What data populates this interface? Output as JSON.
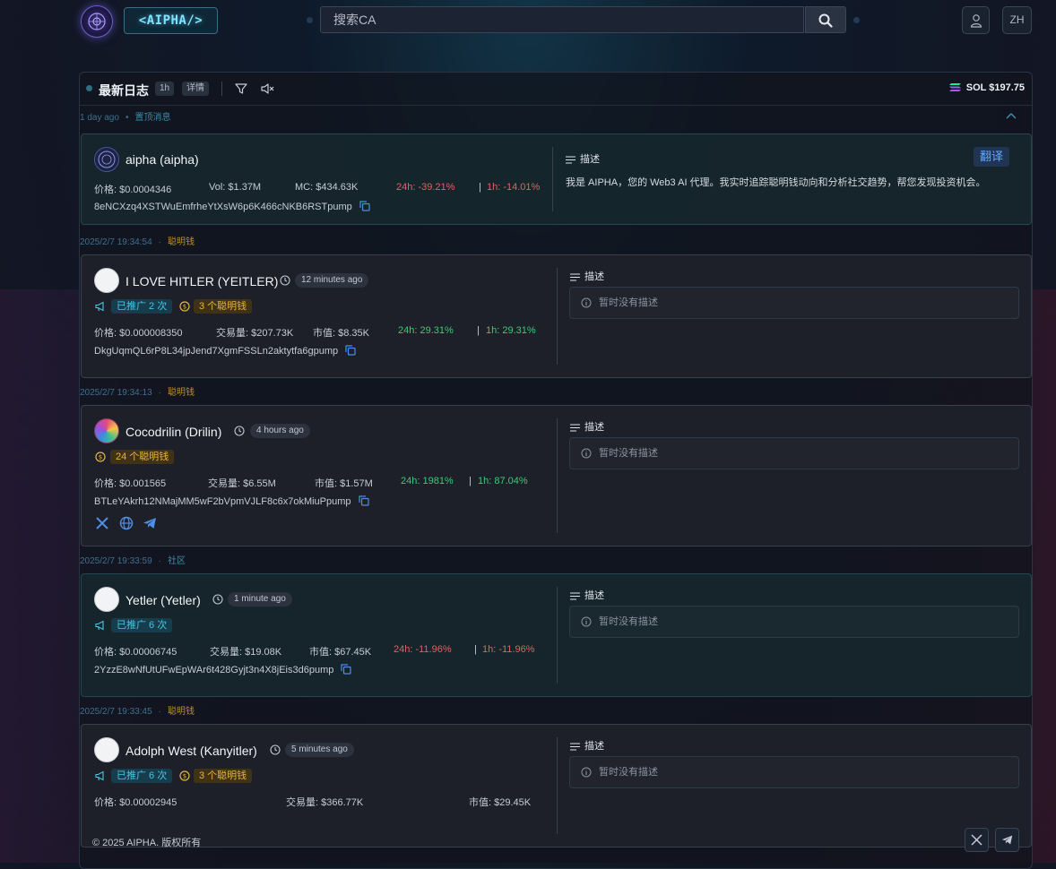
{
  "header": {
    "brand": "<AIPHA/>",
    "search_placeholder": "搜索CA",
    "lang": "ZH"
  },
  "panel": {
    "title": "最新日志",
    "chip_interval": "1h",
    "chip_detail": "详情",
    "sol_price": "SOL $197.75"
  },
  "colors": {
    "positive": "#3ecb76",
    "negative": "#e06262",
    "promo": "#48c6e6",
    "smart": "#e8b53c",
    "accent": "#67a8ff"
  },
  "pinned": {
    "time": "1 day ago",
    "tag": "置顶消息",
    "name": "aipha (aipha)",
    "price": "价格: $0.0004346",
    "vol": "Vol: $1.37M",
    "mc": "MC: $434.63K",
    "change_24h": "24h: -39.21%",
    "sep": "|",
    "change_1h": "1h: -14.01%",
    "address": "8eNCXzq4XSTWuEmfrheYtXsW6p6K466cNKB6RSTpump",
    "desc_title": "描述",
    "translate": "翻译",
    "description": "我是 AIPHA，您的 Web3 AI 代理。我实时追踪聪明钱动向和分析社交趋势，帮您发现投资机会。"
  },
  "entries": [
    {
      "time": "2025/2/7 19:34:54",
      "tag": "聪明钱",
      "name": "I LOVE HITLER (YEITLER)",
      "age": "12 minutes ago",
      "promo": "已推广 2 次",
      "smart": "3 个聪明钱",
      "price": "价格: $0.000008350",
      "volume": "交易量: $207.73K",
      "mcap": "市值: $8.35K",
      "change_24h": "24h: 29.31%",
      "sep": "|",
      "change_1h": "1h: 29.31%",
      "address": "DkgUqmQL6rP8L34jpJend7XgmFSSLn2aktytfa6gpump",
      "desc_title": "描述",
      "desc_empty": "暂时没有描述"
    },
    {
      "time": "2025/2/7 19:34:13",
      "tag": "聪明钱",
      "name": "Cocodrilin (Drilin)",
      "age": "4 hours ago",
      "smart": "24 个聪明钱",
      "price": "价格: $0.001565",
      "volume": "交易量: $6.55M",
      "mcap": "市值: $1.57M",
      "change_24h": "24h: 1981%",
      "sep": "|",
      "change_1h": "1h: 87.04%",
      "address": "BTLeYAkrh12NMajMM5wF2bVpmVJLF8c6x7okMiuPpump",
      "desc_title": "描述",
      "desc_empty": "暂时没有描述"
    },
    {
      "time": "2025/2/7 19:33:59",
      "tag": "社区",
      "name": "Yetler (Yetler)",
      "age": "1 minute ago",
      "promo": "已推广 6 次",
      "price": "价格: $0.00006745",
      "volume": "交易量: $19.08K",
      "mcap": "市值: $67.45K",
      "change_24h": "24h: -11.96%",
      "sep": "|",
      "change_1h": "1h: -11.96%",
      "address": "2YzzE8wNfUtUFwEpWAr6t428Gyjt3n4X8jEis3d6pump",
      "desc_title": "描述",
      "desc_empty": "暂时没有描述"
    },
    {
      "time": "2025/2/7 19:33:45",
      "tag": "聪明钱",
      "name": "Adolph West (Kanyitler)",
      "age": "5 minutes ago",
      "promo": "已推广 6 次",
      "smart": "3 个聪明钱",
      "price": "价格: $0.00002945",
      "volume": "交易量: $366.77K",
      "mcap": "市值: $29.45K",
      "desc_title": "描述",
      "desc_empty": "暂时没有描述"
    }
  ],
  "footer": {
    "copyright": "© 2025 AIPHA. 版权所有"
  }
}
